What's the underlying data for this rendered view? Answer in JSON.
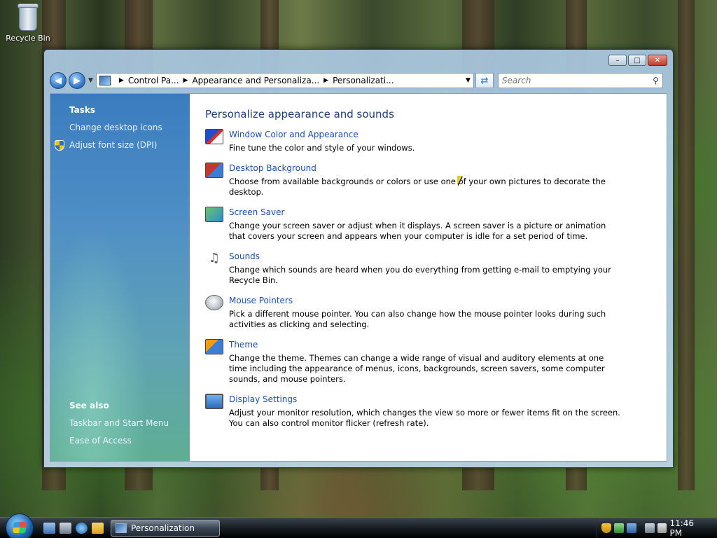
{
  "desktop": {
    "recycle_bin_label": "Recycle Bin"
  },
  "window": {
    "caption_buttons": {
      "minimize": "–",
      "maximize": "□",
      "close": "✕"
    },
    "address": {
      "crumbs": [
        "Control Pa...",
        "Appearance and Personaliza...",
        "Personalizati..."
      ]
    },
    "search": {
      "placeholder": "Search"
    },
    "sidebar": {
      "tasks_heading": "Tasks",
      "tasks": [
        "Change desktop icons",
        "Adjust font size (DPI)"
      ],
      "see_also_heading": "See also",
      "see_also": [
        "Taskbar and Start Menu",
        "Ease of Access"
      ]
    },
    "main": {
      "title": "Personalize appearance and sounds",
      "items": [
        {
          "title": "Window Color and Appearance",
          "desc": "Fine tune the color and style of your windows.",
          "icon": "window-color-icon"
        },
        {
          "title": "Desktop Background",
          "desc": "Choose from available backgrounds or colors or use one of your own pictures to decorate the desktop.",
          "icon": "desktop-background-icon"
        },
        {
          "title": "Screen Saver",
          "desc": "Change your screen saver or adjust when it displays. A screen saver is a picture or animation that covers your screen and appears when your computer is idle for a set period of time.",
          "icon": "screen-saver-icon"
        },
        {
          "title": "Sounds",
          "desc": "Change which sounds are heard when you do everything from getting e-mail to emptying your Recycle Bin.",
          "icon": "sounds-icon"
        },
        {
          "title": "Mouse Pointers",
          "desc": "Pick a different mouse pointer. You can also change how the mouse pointer looks during such activities as clicking and selecting.",
          "icon": "mouse-icon"
        },
        {
          "title": "Theme",
          "desc": "Change the theme. Themes can change a wide range of visual and auditory elements at one time including the appearance of menus, icons, backgrounds, screen savers, some computer sounds, and mouse pointers.",
          "icon": "theme-icon"
        },
        {
          "title": "Display Settings",
          "desc": "Adjust your monitor resolution, which changes the view so more or fewer items fit on the screen. You can also control monitor flicker (refresh rate).",
          "icon": "display-settings-icon"
        }
      ]
    }
  },
  "taskbar": {
    "active_task": "Personalization",
    "clock": "11:46 PM"
  },
  "colors": {
    "link": "#1a4fb5",
    "heading": "#1e3f7a",
    "sidebar_top": "#3a7cbf",
    "sidebar_bottom": "#5fae92"
  }
}
